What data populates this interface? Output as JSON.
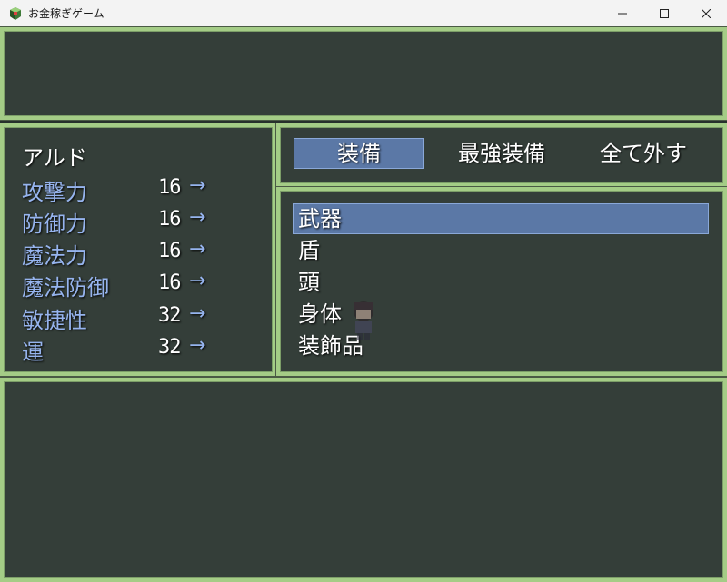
{
  "window": {
    "title": "お金稼ぎゲーム",
    "icons": [
      "app-icon",
      "minimize-icon",
      "maximize-icon",
      "close-icon"
    ]
  },
  "colors": {
    "window_bg": "#343e39",
    "window_border": "#a4cc86",
    "system_text": "#96b4ee",
    "normal_text": "#ffffff",
    "selection": "#5b78a6"
  },
  "status": {
    "actor_name": "アルド",
    "stats": [
      {
        "label": "攻撃力",
        "value": "16",
        "arrow": "→"
      },
      {
        "label": "防御力",
        "value": "16",
        "arrow": "→"
      },
      {
        "label": "魔法力",
        "value": "16",
        "arrow": "→"
      },
      {
        "label": "魔法防御",
        "value": "16",
        "arrow": "→"
      },
      {
        "label": "敏捷性",
        "value": "32",
        "arrow": "→"
      },
      {
        "label": "運",
        "value": "32",
        "arrow": "→"
      }
    ]
  },
  "commands": [
    {
      "label": "装備",
      "selected": true
    },
    {
      "label": "最強装備",
      "selected": false
    },
    {
      "label": "全て外す",
      "selected": false
    }
  ],
  "slots": [
    {
      "label": "武器",
      "selected": true
    },
    {
      "label": "盾",
      "selected": false
    },
    {
      "label": "頭",
      "selected": false
    },
    {
      "label": "身体",
      "selected": false
    },
    {
      "label": "装飾品",
      "selected": false
    }
  ]
}
